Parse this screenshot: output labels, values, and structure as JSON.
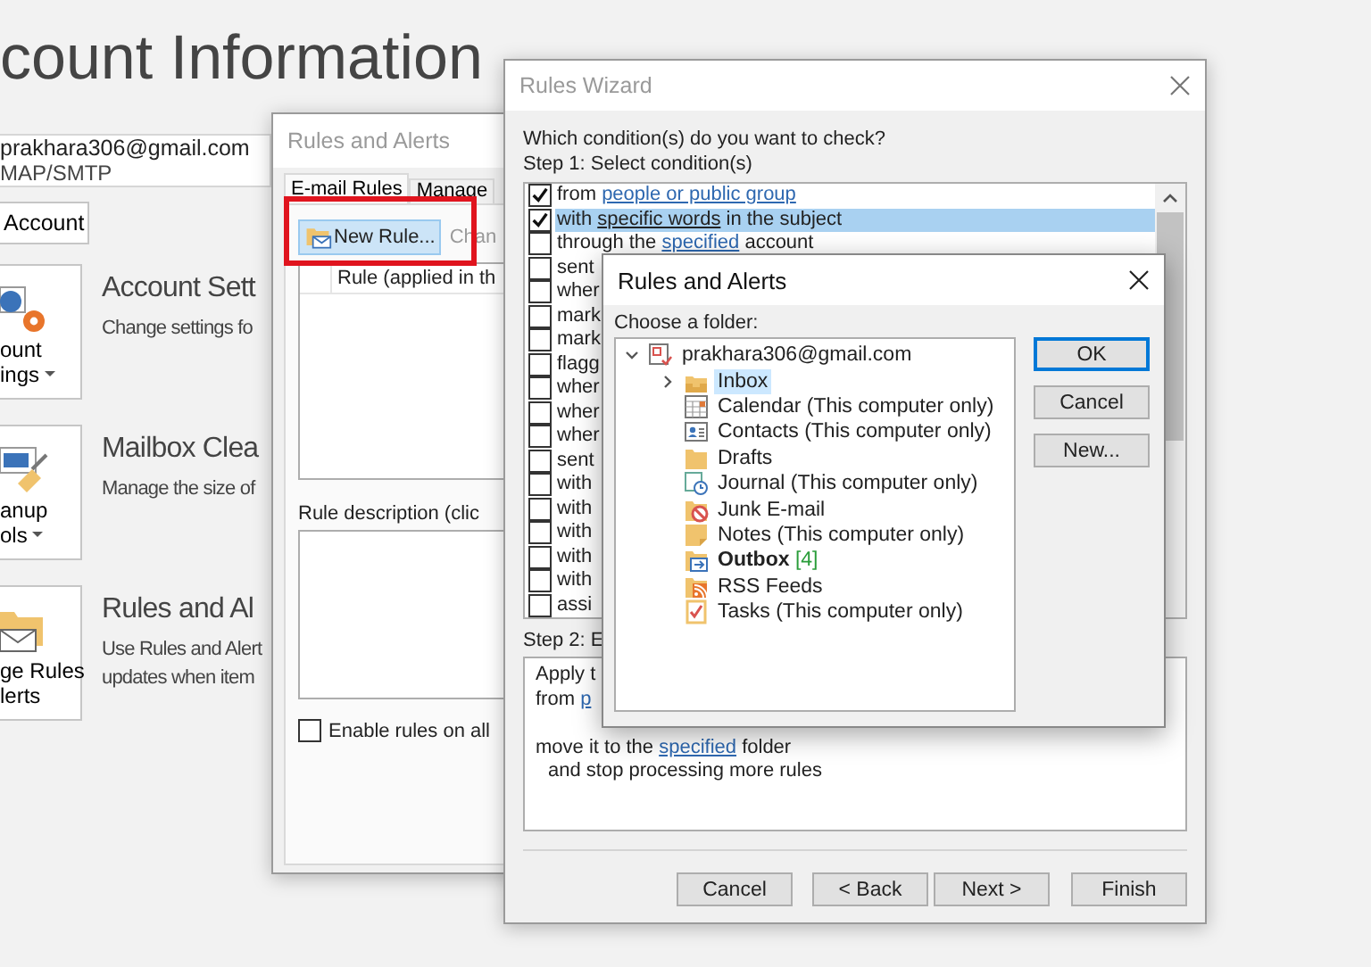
{
  "backstage": {
    "title": "count Information",
    "account": {
      "email": "prakhara306@gmail.com",
      "type": "MAP/SMTP"
    },
    "account_button": "Account",
    "tiles": [
      {
        "kind": "settings",
        "lines": [
          "ount",
          "ings"
        ],
        "dropdown": true,
        "heading": "Account Sett",
        "description": [
          "Change settings fo"
        ]
      },
      {
        "kind": "cleanup",
        "lines": [
          "anup",
          "ols"
        ],
        "dropdown": true,
        "heading": "Mailbox Clea",
        "description": [
          "Manage the size of"
        ]
      },
      {
        "kind": "rules",
        "lines": [
          "ge Rules",
          "lerts"
        ],
        "dropdown": false,
        "heading": "Rules and Al",
        "description": [
          "Use Rules and Alert",
          "updates when item"
        ]
      }
    ]
  },
  "rules_alerts": {
    "title": "Rules and Alerts",
    "tabs": [
      {
        "label": "E-mail Rules",
        "selected": true
      },
      {
        "label": "Manage",
        "selected": false
      }
    ],
    "toolbar": [
      {
        "label": "New Rule...",
        "highlighted": true,
        "disabled": false
      },
      {
        "label": "Chan",
        "highlighted": false,
        "disabled": true
      }
    ],
    "column_header": "Rule (applied in th",
    "description_label": "Rule description (clic",
    "enable_checkbox": {
      "label": "Enable rules on all",
      "checked": false
    }
  },
  "rules_wizard": {
    "title": "Rules Wizard",
    "question": "Which condition(s) do you want to check?",
    "step1_label": "Step 1: Select condition(s)",
    "conditions": [
      {
        "checked": true,
        "selected": false,
        "parts": [
          {
            "text": "from "
          },
          {
            "text": "people or public group",
            "link": true
          }
        ]
      },
      {
        "checked": true,
        "selected": true,
        "parts": [
          {
            "text": "with "
          },
          {
            "text": "specific words",
            "link": true
          },
          {
            "text": " in the subject"
          }
        ]
      },
      {
        "checked": false,
        "selected": false,
        "parts": [
          {
            "text": "through the "
          },
          {
            "text": "specified",
            "link": true
          },
          {
            "text": " account"
          }
        ]
      },
      {
        "checked": false,
        "selected": false,
        "parts": [
          {
            "text": "sent"
          }
        ]
      },
      {
        "checked": false,
        "selected": false,
        "parts": [
          {
            "text": "wher"
          }
        ]
      },
      {
        "checked": false,
        "selected": false,
        "parts": [
          {
            "text": "mark"
          }
        ]
      },
      {
        "checked": false,
        "selected": false,
        "parts": [
          {
            "text": "mark"
          }
        ]
      },
      {
        "checked": false,
        "selected": false,
        "parts": [
          {
            "text": "flagg"
          }
        ]
      },
      {
        "checked": false,
        "selected": false,
        "parts": [
          {
            "text": "wher"
          }
        ]
      },
      {
        "checked": false,
        "selected": false,
        "parts": [
          {
            "text": "wher"
          }
        ]
      },
      {
        "checked": false,
        "selected": false,
        "parts": [
          {
            "text": "wher"
          }
        ]
      },
      {
        "checked": false,
        "selected": false,
        "parts": [
          {
            "text": "sent"
          }
        ]
      },
      {
        "checked": false,
        "selected": false,
        "parts": [
          {
            "text": "with"
          }
        ]
      },
      {
        "checked": false,
        "selected": false,
        "parts": [
          {
            "text": "with"
          }
        ]
      },
      {
        "checked": false,
        "selected": false,
        "parts": [
          {
            "text": "with"
          }
        ]
      },
      {
        "checked": false,
        "selected": false,
        "parts": [
          {
            "text": "with"
          }
        ]
      },
      {
        "checked": false,
        "selected": false,
        "parts": [
          {
            "text": "with"
          }
        ]
      },
      {
        "checked": false,
        "selected": false,
        "parts": [
          {
            "text": "assi"
          }
        ]
      }
    ],
    "step2_label": "Step 2: E",
    "description": [
      {
        "indent": false,
        "parts": [
          {
            "text": "Apply t"
          }
        ]
      },
      {
        "indent": false,
        "parts": [
          {
            "text": "from "
          },
          {
            "text": "p",
            "link": true
          }
        ]
      },
      {
        "indent": false,
        "parts": [
          {
            "text": "move it to the "
          },
          {
            "text": "specified",
            "link": true
          },
          {
            "text": " folder"
          }
        ]
      },
      {
        "indent": true,
        "parts": [
          {
            "text": "and stop processing more rules"
          }
        ]
      }
    ],
    "buttons": [
      {
        "label": "Cancel"
      },
      {
        "label": "< Back"
      },
      {
        "label": "Next >"
      },
      {
        "label": "Finish"
      }
    ]
  },
  "folder_dialog": {
    "title": "Rules and Alerts",
    "prompt": "Choose a folder:",
    "tree": {
      "label": "prakhara306@gmail.com",
      "kind": "account",
      "expanded": true,
      "selected": false,
      "bold": false,
      "children": [
        {
          "label": "Inbox",
          "kind": "inbox",
          "expanded": false,
          "selected": true,
          "bold": false
        },
        {
          "label": "Calendar (This computer only)",
          "kind": "calendar",
          "selected": false,
          "bold": false
        },
        {
          "label": "Contacts (This computer only)",
          "kind": "contacts",
          "selected": false,
          "bold": false
        },
        {
          "label": "Drafts",
          "kind": "folder",
          "selected": false,
          "bold": false
        },
        {
          "label": "Journal (This computer only)",
          "kind": "journal",
          "selected": false,
          "bold": false
        },
        {
          "label": "Junk E-mail",
          "kind": "junk",
          "selected": false,
          "bold": false
        },
        {
          "label": "Notes (This computer only)",
          "kind": "notes",
          "selected": false,
          "bold": false
        },
        {
          "label": "Outbox",
          "count": "[4]",
          "kind": "outbox",
          "selected": false,
          "bold": true
        },
        {
          "label": "RSS Feeds",
          "kind": "rss",
          "selected": false,
          "bold": false
        },
        {
          "label": "Tasks (This computer only)",
          "kind": "tasks",
          "selected": false,
          "bold": false
        }
      ]
    },
    "buttons": [
      {
        "label": "OK",
        "default": true
      },
      {
        "label": "Cancel",
        "default": false
      },
      {
        "label": "New...",
        "default": false
      }
    ]
  }
}
